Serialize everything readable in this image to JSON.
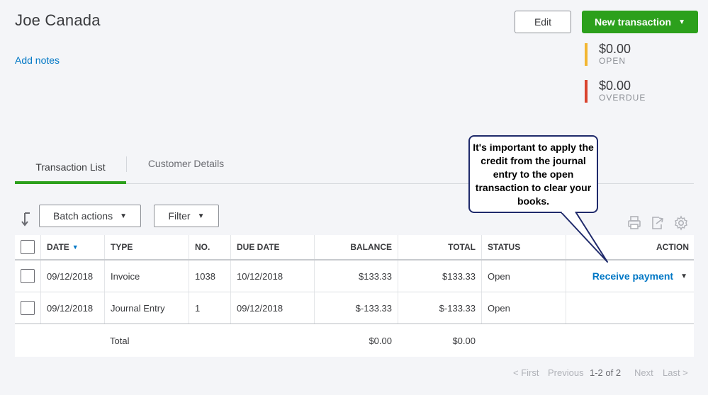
{
  "customer": {
    "name": "Joe Canada",
    "add_notes": "Add notes"
  },
  "header": {
    "edit_label": "Edit",
    "new_transaction_label": "New transaction"
  },
  "stats": [
    {
      "amount": "$0.00",
      "label": "OPEN",
      "color": "#f2b631"
    },
    {
      "amount": "$0.00",
      "label": "OVERDUE",
      "color": "#d9432e"
    }
  ],
  "tabs": [
    {
      "label": "Transaction List",
      "active": true
    },
    {
      "label": "Customer Details",
      "active": false
    }
  ],
  "toolbar": {
    "batch_actions": "Batch actions",
    "filter": "Filter"
  },
  "icons": {
    "sort": "sort-down-icon",
    "print": "printer-icon",
    "export": "export-icon",
    "settings": "gear-icon"
  },
  "table": {
    "columns": [
      "DATE",
      "TYPE",
      "NO.",
      "DUE DATE",
      "BALANCE",
      "TOTAL",
      "STATUS",
      "ACTION"
    ],
    "rows": [
      {
        "date": "09/12/2018",
        "type": "Invoice",
        "no": "1038",
        "due_date": "10/12/2018",
        "balance": "$133.33",
        "total": "$133.33",
        "status": "Open",
        "action": "Receive payment"
      },
      {
        "date": "09/12/2018",
        "type": "Journal Entry",
        "no": "1",
        "due_date": "09/12/2018",
        "balance": "$-133.33",
        "total": "$-133.33",
        "status": "Open",
        "action": ""
      }
    ],
    "total_row": {
      "label": "Total",
      "balance": "$0.00",
      "total": "$0.00"
    }
  },
  "pagination": {
    "first": "< First",
    "previous": "Previous",
    "range": "1-2 of 2",
    "next": "Next",
    "last": "Last >"
  },
  "callout": {
    "text": "It's important to apply the credit from the journal entry to the open transaction to clear your books."
  },
  "colors": {
    "brand_green": "#2ca01c",
    "link_blue": "#0077c5",
    "callout_border": "#1f2a6b"
  }
}
